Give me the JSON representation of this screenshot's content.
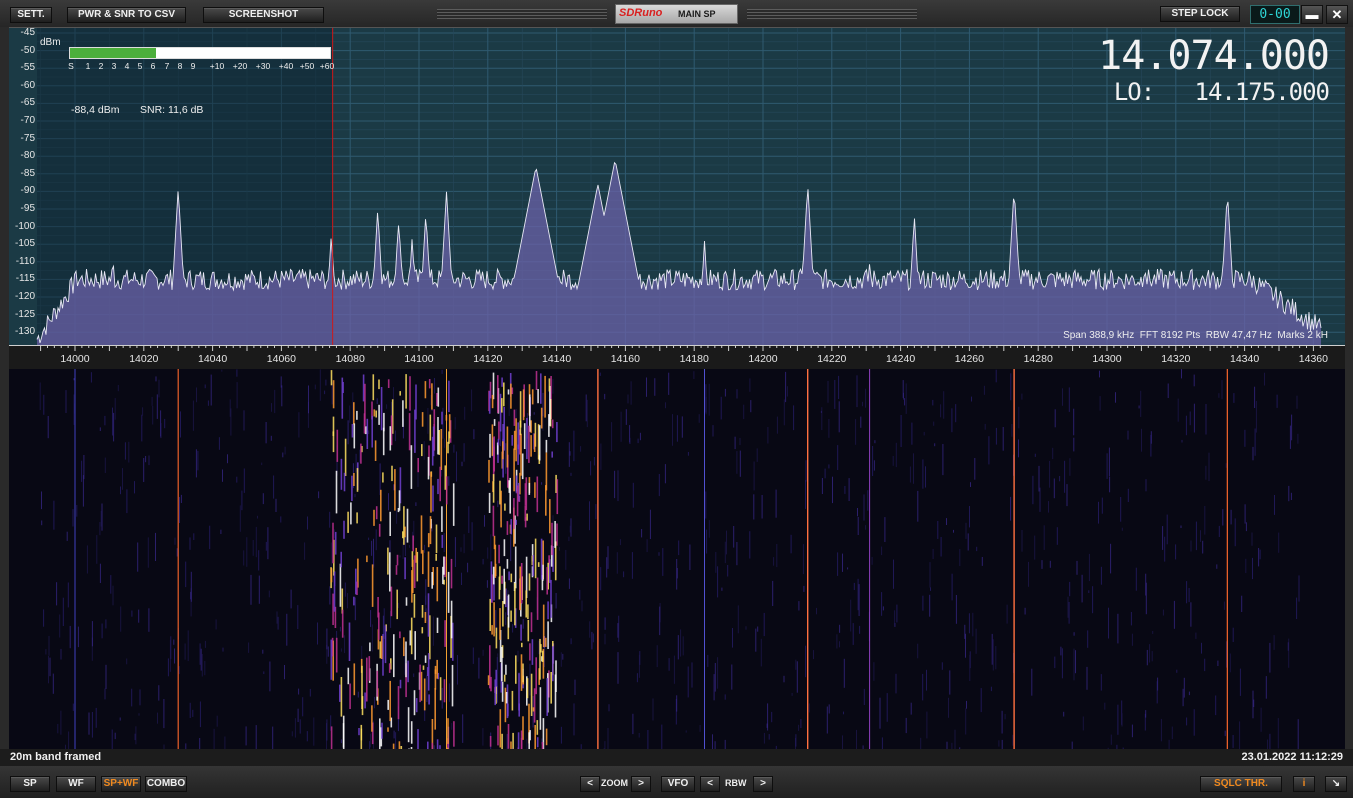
{
  "toolbar": {
    "settings": "SETT.",
    "export": "PWR & SNR TO CSV",
    "screenshot": "SCREENSHOT",
    "step_lock": "STEP LOCK",
    "step_display": "0-00",
    "minimize": "▬",
    "close": "✕"
  },
  "logo": {
    "brand": "SDRuno",
    "panel": "MAIN SP"
  },
  "meter": {
    "unit": "dBm",
    "labels": [
      "S",
      "1",
      "2",
      "3",
      "4",
      "5",
      "6",
      "7",
      "8",
      "9",
      "+10",
      "+20",
      "+30",
      "+40",
      "+50",
      "+60"
    ],
    "fill_fraction": 0.33,
    "power": "-88,4 dBm",
    "snr": "SNR: 11,6 dB"
  },
  "frequency": {
    "vfo": "14.074.000",
    "lo": "LO:   14.175.000"
  },
  "spectrum": {
    "y_ticks": [
      "-45",
      "-50",
      "-55",
      "-60",
      "-65",
      "-70",
      "-75",
      "-80",
      "-85",
      "-90",
      "-95",
      "-100",
      "-105",
      "-110",
      "-115",
      "-120",
      "-125",
      "-130"
    ],
    "x_ticks": [
      "14000",
      "14020",
      "14040",
      "14060",
      "14080",
      "14100",
      "14120",
      "14140",
      "14160",
      "14180",
      "14200",
      "14220",
      "14240",
      "14260",
      "14280",
      "14300",
      "14320",
      "14340",
      "14360"
    ],
    "info": "Span 388,9 kHz  FFT 8192 Pts  RBW 47,47 Hz  Marks 2 kH",
    "fill_color": "#6b62a8",
    "background_color": "#1b3a45",
    "marker_color": "#d01818"
  },
  "status": {
    "left": "20m band framed",
    "right": "23.01.2022 11:12:29"
  },
  "bottom": {
    "sp": "SP",
    "wf": "WF",
    "spwf": "SP+WF",
    "combo": "COMBO",
    "zoom": "ZOOM",
    "vfo": "VFO",
    "rbw": "RBW",
    "sqlc": "SQLC THR.",
    "info": "i",
    "resize": "↘"
  }
}
